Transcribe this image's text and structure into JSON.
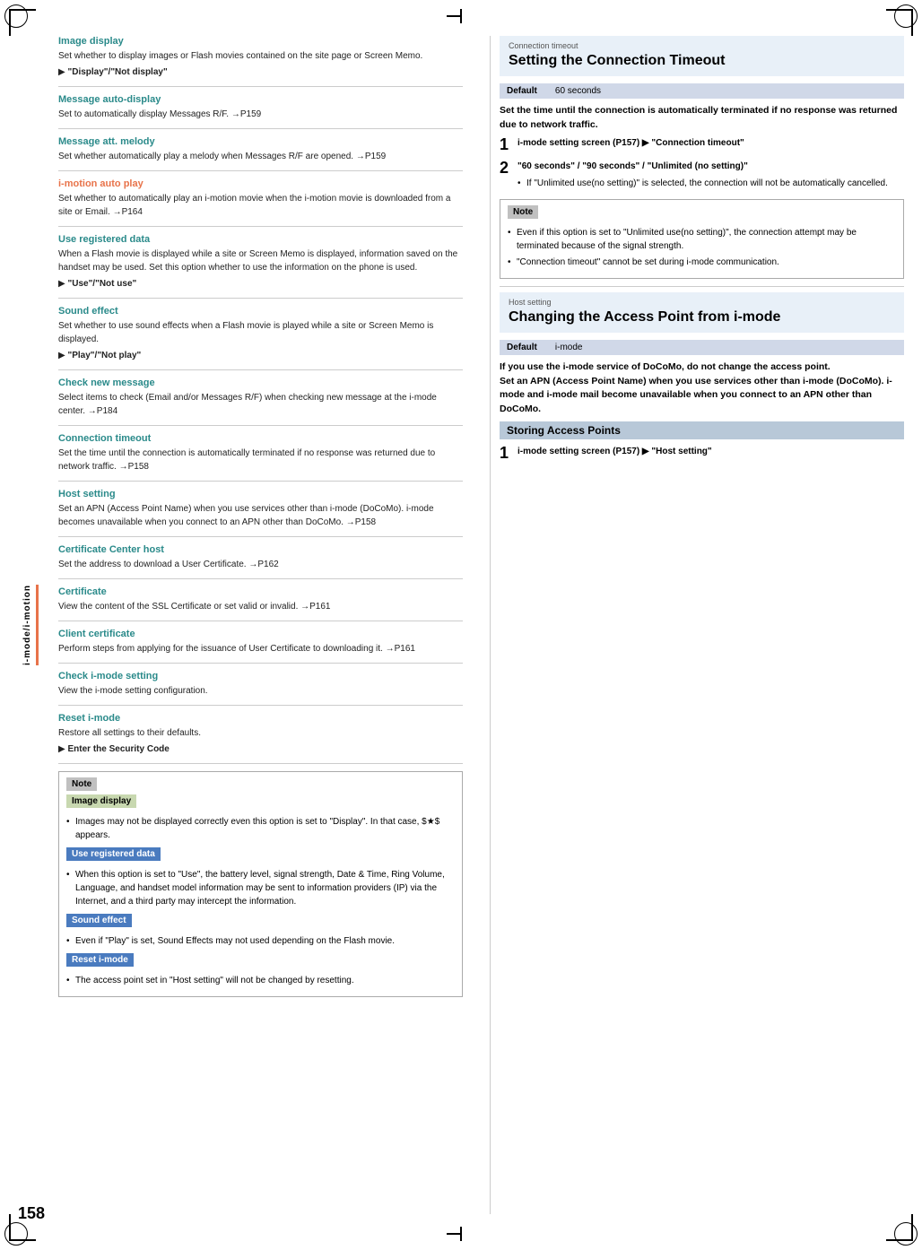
{
  "page": {
    "number": "158",
    "sidebar_label": "i-mode/i-motion"
  },
  "left_column": {
    "sections": [
      {
        "id": "image-display",
        "title": "Image display",
        "color": "teal",
        "body": "Set whether to display images or Flash movies contained on the site page or Screen Memo.",
        "arrow_item": "\"Display\"/\"Not display\""
      },
      {
        "id": "message-auto-display",
        "title": "Message auto-display",
        "color": "teal",
        "body": "Set to automatically display Messages R/F. →P159"
      },
      {
        "id": "message-att-melody",
        "title": "Message att. melody",
        "color": "teal",
        "body": "Set whether automatically play a melody when Messages R/F are opened. →P159"
      },
      {
        "id": "i-motion-auto-play",
        "title": "i-motion auto play",
        "color": "orange",
        "body": "Set whether to automatically play an i-motion movie when the i-motion movie is downloaded from a site or Email. →P164"
      },
      {
        "id": "use-registered-data",
        "title": "Use registered data",
        "color": "teal",
        "body": "When a Flash movie is displayed while a site or Screen Memo is displayed, information saved on the handset may be used. Set this option whether to use the information on the phone is used.",
        "arrow_item": "\"Use\"/\"Not use\""
      },
      {
        "id": "sound-effect",
        "title": "Sound effect",
        "color": "teal",
        "body": "Set whether to use sound effects when a Flash movie is played while a site or Screen Memo is displayed.",
        "arrow_item": "\"Play\"/\"Not play\""
      },
      {
        "id": "check-new-message",
        "title": "Check new message",
        "color": "teal",
        "body": "Select items to check (Email and/or Messages R/F) when checking new message at the i-mode center. →P184"
      },
      {
        "id": "connection-timeout",
        "title": "Connection timeout",
        "color": "teal",
        "body": "Set the time until the connection is automatically terminated if no response was returned due to network traffic. →P158"
      },
      {
        "id": "host-setting",
        "title": "Host setting",
        "color": "teal",
        "body": "Set an APN (Access Point Name) when you use services other than i-mode (DoCoMo). i-mode becomes unavailable when you connect to an APN other than DoCoMo. →P158"
      },
      {
        "id": "certificate-center-host",
        "title": "Certificate Center host",
        "color": "teal",
        "body": "Set the address to download a User Certificate. →P162"
      },
      {
        "id": "certificate",
        "title": "Certificate",
        "color": "teal",
        "body": "View the content of the SSL Certificate or set valid or invalid. →P161"
      },
      {
        "id": "client-certificate",
        "title": "Client certificate",
        "color": "teal",
        "body": "Perform steps from applying for the issuance of User Certificate to downloading it. →P161"
      },
      {
        "id": "check-i-mode-setting",
        "title": "Check i-mode setting",
        "color": "teal",
        "body": "View the i-mode setting configuration."
      },
      {
        "id": "reset-i-mode",
        "title": "Reset i-mode",
        "color": "teal",
        "body": "Restore all settings to their defaults.",
        "arrow_item": "Enter the Security Code"
      }
    ],
    "note_section": {
      "title": "Note",
      "subsections": [
        {
          "label": "Image display",
          "label_type": "img-bg",
          "bullets": [
            "Images may not be displayed correctly even this option is set to \"Display\". In that case, $★$ appears."
          ]
        },
        {
          "label": "Use registered data",
          "label_type": "blue",
          "bullets": [
            "When this option is set to \"Use\", the battery level, signal strength, Date & Time, Ring Volume, Language, and handset model information may be sent to information providers (IP) via the Internet, and a third party may intercept the information."
          ]
        },
        {
          "label": "Sound effect",
          "label_type": "blue",
          "bullets": [
            "Even if \"Play\" is set, Sound Effects may not used depending on the Flash movie."
          ]
        },
        {
          "label": "Reset i-mode",
          "label_type": "blue",
          "bullets": [
            "The access point set in \"Host setting\" will not be changed by resetting."
          ]
        }
      ]
    }
  },
  "right_column": {
    "connection_timeout_section": {
      "box_label": "Connection timeout",
      "heading": "Setting the Connection Timeout",
      "default_label": "Default",
      "default_value": "60 seconds",
      "intro_text": "Set the time until the connection is automatically terminated if no response was returned due to network traffic.",
      "steps": [
        {
          "num": "1",
          "text": "i-mode setting screen (P157) ▶ \"Connection timeout\""
        },
        {
          "num": "2",
          "text": "\"60 seconds\" / \"90 seconds\" / \"Unlimited (no setting)\""
        }
      ],
      "bullet": "If \"Unlimited use(no setting)\" is selected, the connection will not be automatically cancelled.",
      "note_title": "Note",
      "note_bullets": [
        "Even if this option is set to \"Unlimited use(no setting)\", the connection attempt may be terminated because of the signal strength.",
        "\"Connection timeout\" cannot be set during i-mode communication."
      ]
    },
    "host_setting_section": {
      "box_label": "Host setting",
      "heading": "Changing the Access Point from i-mode",
      "default_label": "Default",
      "default_value": "i-mode",
      "intro_bold": "If you use the i-mode service of DoCoMo, do not change the access point.",
      "intro_text": "Set an APN (Access Point Name) when you use services other than i-mode (DoCoMo). i-mode and i-mode mail become unavailable when you connect to an APN other than DoCoMo.",
      "storing_label": "Storing Access Points",
      "step1_text": "i-mode setting screen (P157) ▶ \"Host setting\""
    }
  }
}
